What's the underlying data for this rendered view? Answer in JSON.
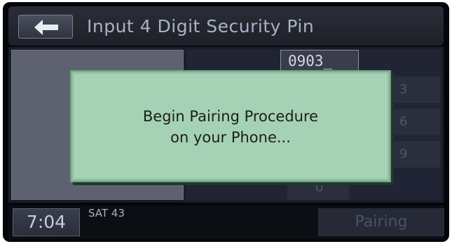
{
  "header": {
    "title": "Input 4 Digit Security Pin",
    "back_icon": "back-arrow-icon"
  },
  "pin_entry": {
    "value": "0903_"
  },
  "keypad": {
    "keys": [
      "3",
      "6",
      "9",
      "0"
    ]
  },
  "popup": {
    "line1": "Begin Pairing Procedure",
    "line2": "on your Phone..."
  },
  "status_bar": {
    "time": "7:04",
    "station": "SAT 43",
    "pairing_label": "Pairing"
  },
  "colors": {
    "popup_bg": "#a5d2b4",
    "screen_bg": "#05060a"
  }
}
